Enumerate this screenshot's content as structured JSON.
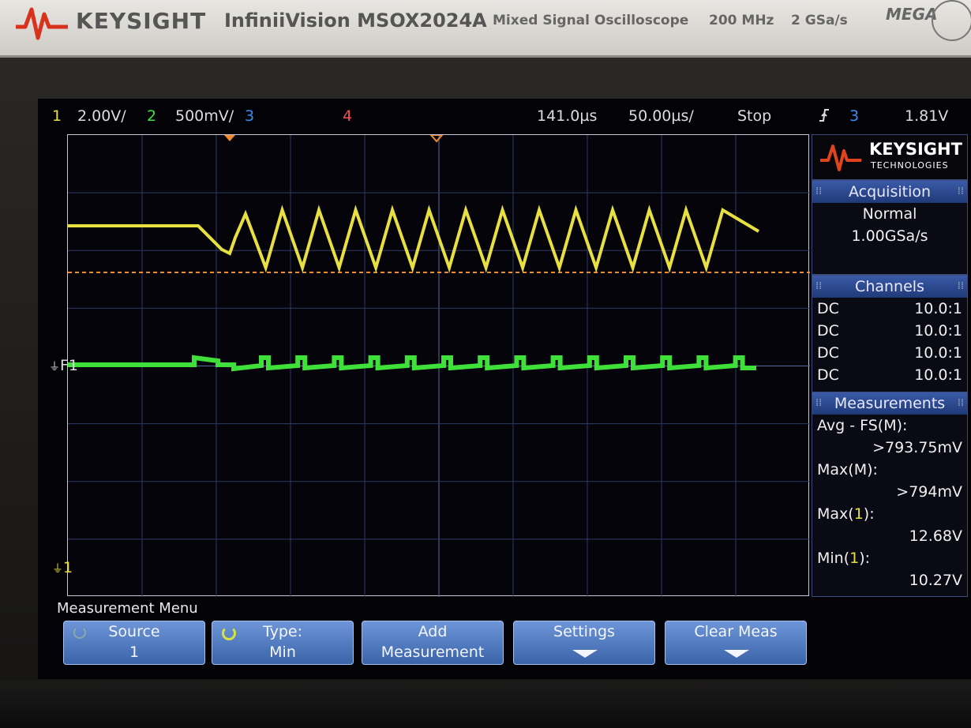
{
  "header": {
    "brand": "KEYSIGHT",
    "model": "InfiniiVision MSOX2024A",
    "description": "Mixed Signal Oscilloscope",
    "bandwidth": "200 MHz",
    "sample_rate": "2 GSa/s",
    "badge": "MEGA"
  },
  "status_bar": {
    "ch1_num": "1",
    "ch1_scale": "2.00V/",
    "ch2_num": "2",
    "ch2_scale": "500mV/",
    "ch3_num": "3",
    "ch4_num": "4",
    "time_delay": "141.0µs",
    "time_scale": "50.00µs/",
    "run_state": "Stop",
    "trigger_slope": "rising-edge-icon",
    "trigger_source": "3",
    "trigger_level": "1.81V"
  },
  "markers": {
    "ch1_ground": "1",
    "f1_label": "F1"
  },
  "side_panel": {
    "logo_line1": "KEYSIGHT",
    "logo_line2": "TECHNOLOGIES",
    "acquisition": {
      "title": "Acquisition",
      "mode": "Normal",
      "rate": "1.00GSa/s"
    },
    "channels": {
      "title": "Channels",
      "rows": [
        {
          "coupling": "DC",
          "probe": "10.0:1"
        },
        {
          "coupling": "DC",
          "probe": "10.0:1"
        },
        {
          "coupling": "DC",
          "probe": "10.0:1"
        },
        {
          "coupling": "DC",
          "probe": "10.0:1"
        }
      ]
    },
    "measurements": {
      "title": "Measurements",
      "items": [
        {
          "label": "Avg - FS(M):",
          "value": ">793.75mV"
        },
        {
          "label": "Max(M):",
          "value": ">794mV"
        },
        {
          "label": "Max(1):",
          "value": "12.68V"
        },
        {
          "label": "Min(1):",
          "value": "10.27V"
        }
      ]
    }
  },
  "menu": {
    "title": "Measurement Menu",
    "softkeys": [
      {
        "line1": "Source",
        "line2": "1"
      },
      {
        "line1": "Type:",
        "line2": "Min"
      },
      {
        "line1": "Add",
        "line2": "Measurement"
      },
      {
        "line1": "Settings",
        "line2": ""
      },
      {
        "line1": "Clear Meas",
        "line2": ""
      }
    ]
  },
  "colors": {
    "ch1": "#e8e040",
    "ch2": "#3fe03a",
    "ch3": "#3a8ef0",
    "ch4": "#f0505a",
    "trigger_level_line": "#f08a30",
    "softkey": "#4f77c0"
  }
}
